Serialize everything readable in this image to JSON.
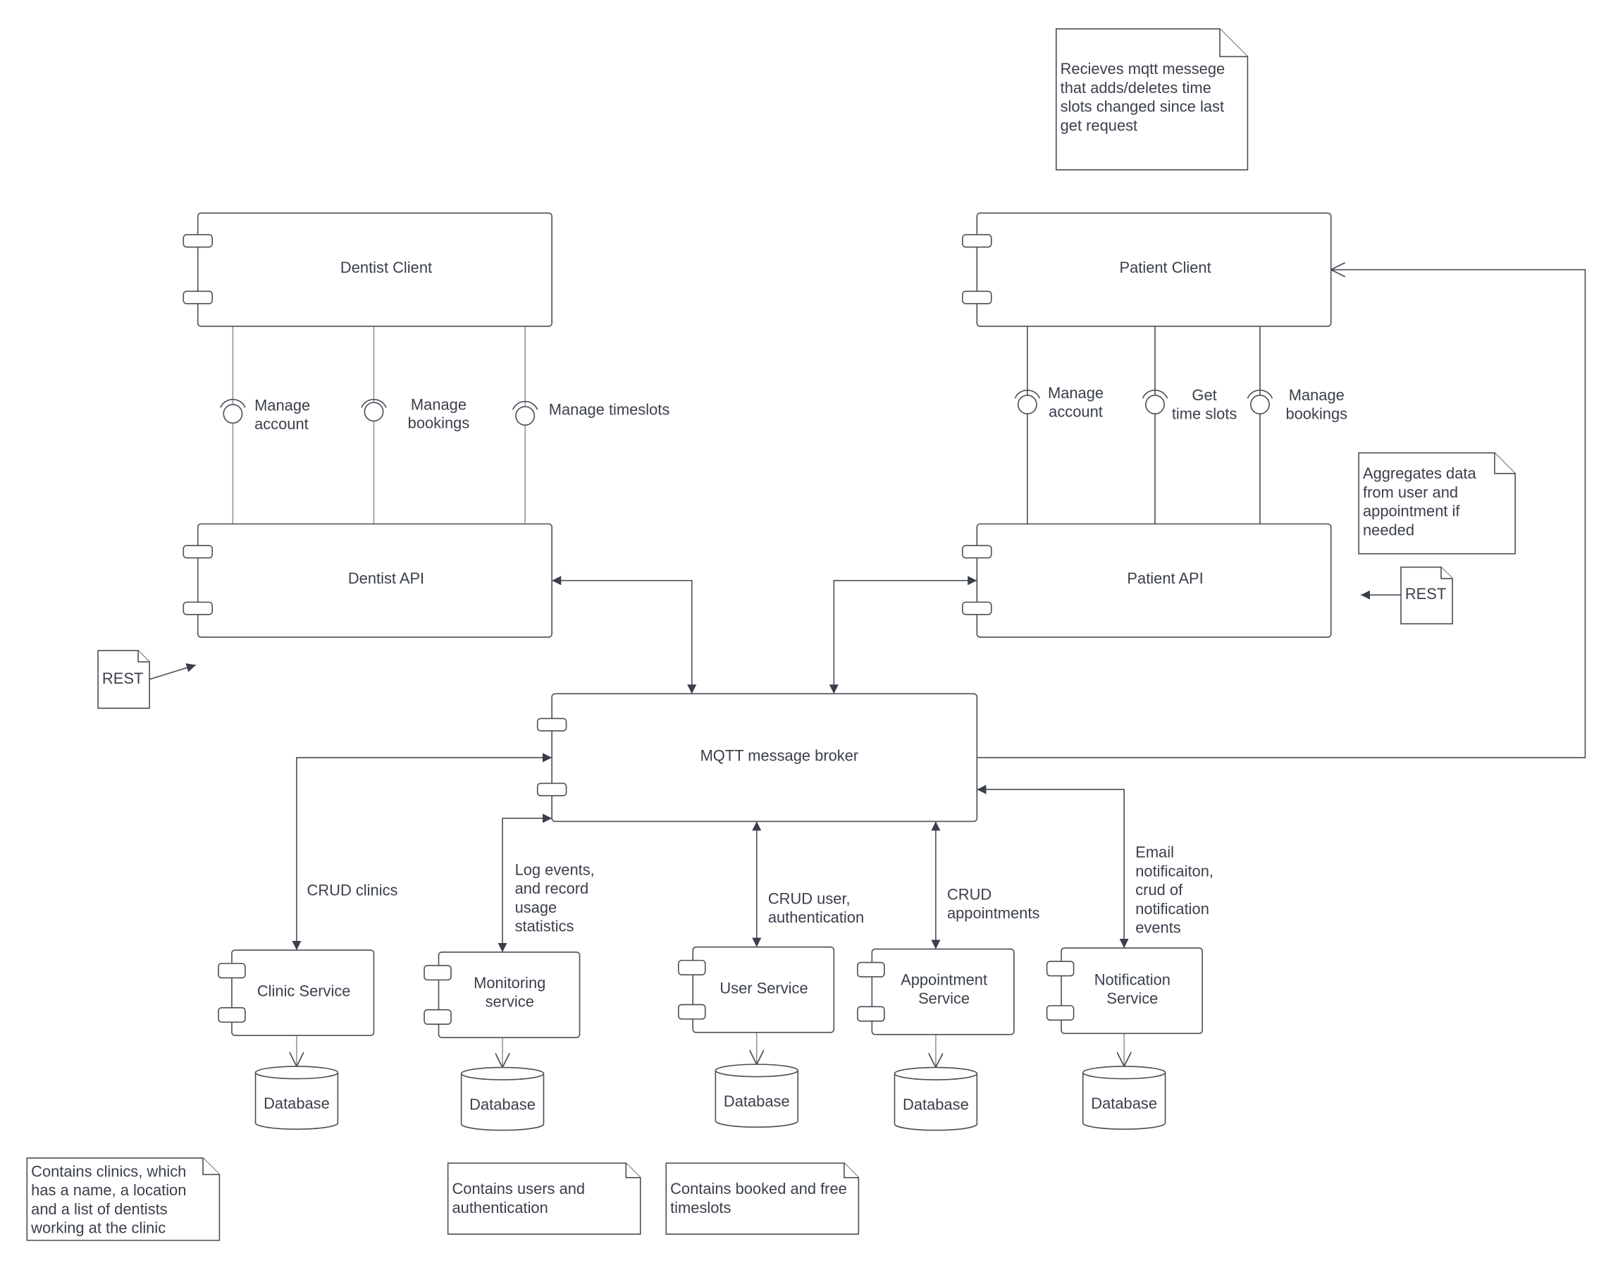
{
  "components": {
    "dentist_client": "Dentist Client",
    "dentist_api": "Dentist API",
    "patient_client": "Patient Client",
    "patient_api": "Patient API",
    "broker": "MQTT message broker",
    "clinic_service": "Clinic Service",
    "monitoring_service": [
      "Monitoring",
      "service"
    ],
    "user_service": "User Service",
    "appointment_service": [
      "Appointment",
      "Service"
    ],
    "notification_service": [
      "Notification",
      "Service"
    ]
  },
  "databases": [
    "Database",
    "Database",
    "Database",
    "Database",
    "Database"
  ],
  "interfaces": {
    "dentist": [
      [
        "Manage",
        "account"
      ],
      [
        "Manage",
        "bookings"
      ],
      [
        "Manage timeslots"
      ]
    ],
    "patient": [
      [
        "Manage",
        "account"
      ],
      [
        "Get",
        "time slots"
      ],
      [
        "Manage",
        "bookings"
      ]
    ]
  },
  "edge_labels": {
    "clinic": "CRUD clinics",
    "monitoring": [
      "Log events,",
      "and record",
      "usage",
      "statistics"
    ],
    "user": [
      "CRUD user,",
      "authentication"
    ],
    "appointment": [
      "CRUD",
      "appointments"
    ],
    "notification": [
      "Email",
      "notificaiton,",
      "crud of",
      "notification",
      "events"
    ]
  },
  "notes": {
    "patient_client": [
      "Recieves mqtt messege",
      "that adds/deletes time",
      "slots changed since last",
      "get request"
    ],
    "patient_api": [
      "Aggregates data",
      "from user and",
      "appointment if",
      "needed"
    ],
    "rest_left": "REST",
    "rest_right": "REST",
    "clinic_db": [
      "Contains clinics, which",
      "has a name, a location",
      "and a list of dentists",
      "working at the clinic"
    ],
    "user_db": [
      "Contains users and",
      "authentication"
    ],
    "appointment_db": [
      "Contains booked and free",
      "timeslots"
    ]
  }
}
